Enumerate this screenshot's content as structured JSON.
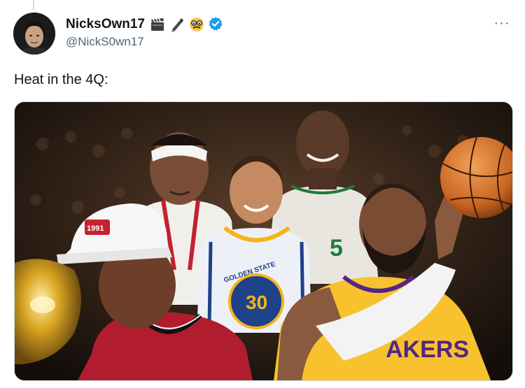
{
  "tweet": {
    "display_name": "NicksOwn17",
    "handle": "@NickS0wn17",
    "verified": true,
    "name_emojis": [
      "clapperboard-icon",
      "pen-icon",
      "disguise-face-icon"
    ],
    "text": "Heat in the 4Q:",
    "more_label": "···"
  },
  "media": {
    "description_icons": [
      "player-photo"
    ],
    "jersey_numbers": [
      "30"
    ],
    "jersey_texts": [
      "GOLDEN STATE",
      "AKERS"
    ],
    "cap_text": "1991"
  },
  "colors": {
    "accent_blue": "#1d9bf0",
    "secondary_text": "#536471",
    "primary_text": "#0f1419"
  }
}
